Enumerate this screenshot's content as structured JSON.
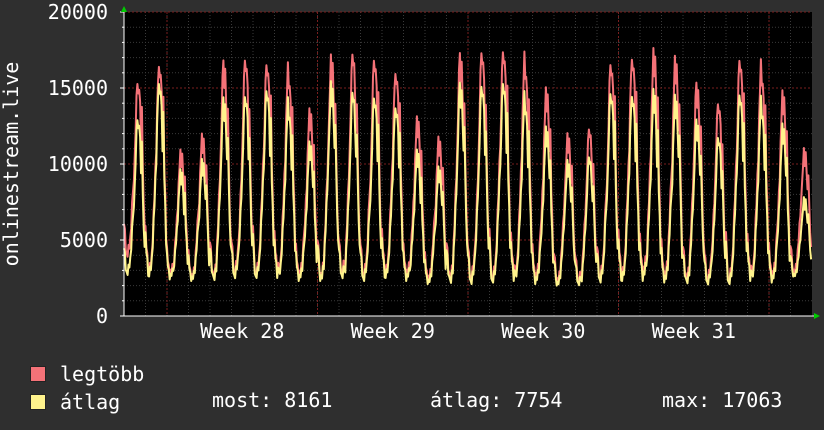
{
  "chart_data": {
    "type": "line",
    "ylabel": "onlinestream.live",
    "ylim": [
      0,
      20000
    ],
    "y_ticks": [
      "0",
      "5000",
      "10000",
      "15000",
      "20000"
    ],
    "x_tick_labels": [
      "Week 28",
      "Week 29",
      "Week 30",
      "Week 31"
    ],
    "grid": true,
    "days": 32,
    "series": [
      {
        "name": "legtöbb",
        "color": "#f47278",
        "daily_peaks": [
          16000,
          17400,
          11000,
          12200,
          17300,
          17500,
          17400,
          16700,
          13800,
          17600,
          17800,
          17600,
          16900,
          13200,
          12000,
          17800,
          18000,
          18300,
          17400,
          15200,
          12300,
          12700,
          17300,
          17900,
          17700,
          17400,
          15800,
          14500,
          17700,
          16900,
          15000,
          11300
        ],
        "daily_mins": [
          3900,
          2800,
          2600,
          2400,
          2400,
          2600,
          2700,
          2700,
          2500,
          2400,
          2500,
          2500,
          2700,
          2500,
          2300,
          2300,
          2200,
          2400,
          2500,
          2300,
          2200,
          2100,
          2400,
          2500,
          2500,
          2400,
          2300,
          2200,
          2300,
          2500,
          2400,
          2800
        ]
      },
      {
        "name": "átlag",
        "color": "#fff38c",
        "daily_peaks": [
          13500,
          16200,
          9700,
          10500,
          14800,
          15000,
          15600,
          14400,
          11600,
          15800,
          15200,
          15000,
          14500,
          11000,
          10000,
          15800,
          15700,
          16100,
          14800,
          12600,
          10500,
          10800,
          15300,
          15300,
          15000,
          14800,
          13300,
          12200,
          15300,
          14500,
          12800,
          8000
        ],
        "daily_mins": [
          2700,
          2600,
          2400,
          2300,
          2300,
          2400,
          2500,
          2500,
          2300,
          2300,
          2300,
          2300,
          2500,
          2300,
          2100,
          2100,
          2000,
          2200,
          2300,
          2100,
          2000,
          1900,
          2200,
          2300,
          2300,
          2200,
          2100,
          2000,
          2100,
          2300,
          2200,
          2600
        ]
      }
    ]
  },
  "legend": {
    "max_label": "legtöbb",
    "avg_label": "átlag"
  },
  "stats": {
    "current": "most: 8161",
    "average": "átlag: 7754",
    "maximum": "max: 17063"
  },
  "colors": {
    "background": "#2f2f2f",
    "plot_background": "#000000",
    "grid_major": "#7a1e1e",
    "grid_minor": "#3a3a3a",
    "axis": "#ffffff",
    "arrow": "#00cc00"
  }
}
